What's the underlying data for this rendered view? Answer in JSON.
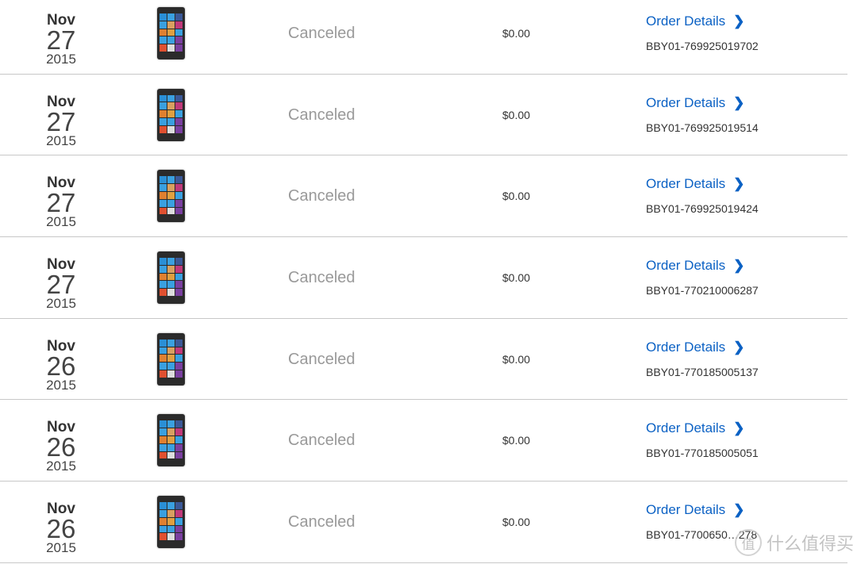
{
  "orders": [
    {
      "month": "Nov",
      "day": "27",
      "year": "2015",
      "status": "Canceled",
      "price": "$0.00",
      "details_label": "Order Details",
      "order_number": "BBY01-769925019702"
    },
    {
      "month": "Nov",
      "day": "27",
      "year": "2015",
      "status": "Canceled",
      "price": "$0.00",
      "details_label": "Order Details",
      "order_number": "BBY01-769925019514"
    },
    {
      "month": "Nov",
      "day": "27",
      "year": "2015",
      "status": "Canceled",
      "price": "$0.00",
      "details_label": "Order Details",
      "order_number": "BBY01-769925019424"
    },
    {
      "month": "Nov",
      "day": "27",
      "year": "2015",
      "status": "Canceled",
      "price": "$0.00",
      "details_label": "Order Details",
      "order_number": "BBY01-770210006287"
    },
    {
      "month": "Nov",
      "day": "26",
      "year": "2015",
      "status": "Canceled",
      "price": "$0.00",
      "details_label": "Order Details",
      "order_number": "BBY01-770185005137"
    },
    {
      "month": "Nov",
      "day": "26",
      "year": "2015",
      "status": "Canceled",
      "price": "$0.00",
      "details_label": "Order Details",
      "order_number": "BBY01-770185005051"
    },
    {
      "month": "Nov",
      "day": "26",
      "year": "2015",
      "status": "Canceled",
      "price": "$0.00",
      "details_label": "Order Details",
      "order_number": "BBY01-7700650…278"
    }
  ],
  "chevron_icon": "chevron-right-icon",
  "product_icon": "windows-phone-image",
  "tile_colors": [
    "#2a8fd6",
    "#3aa0e0",
    "#3b5998",
    "#3aa0e0",
    "#d9a060",
    "#c0397a",
    "#e08030",
    "#e0a040",
    "#3aa0e0",
    "#3aa0e0",
    "#3aa0e0",
    "#7a3fa0",
    "#e05030",
    "#dddddd",
    "#7a3fa0"
  ],
  "link_color": "#0b61c4",
  "watermark": {
    "badge": "值",
    "text": "什么值得买"
  }
}
